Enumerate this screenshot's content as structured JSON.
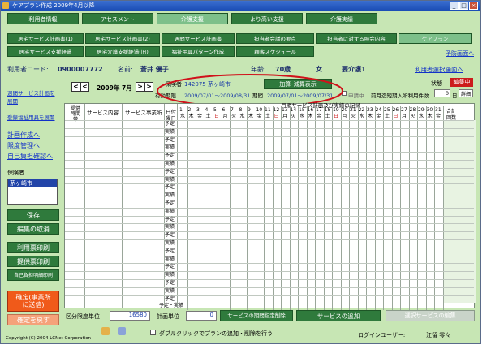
{
  "title": "ケアプラン作成 2009年4月以降",
  "main_tabs": [
    "利用者情報",
    "アセスメント",
    "介護支援",
    "より高い支援",
    "介護実績"
  ],
  "sub_row1": [
    "居宅サービス計画書(1)",
    "居宅サービス計画書(2)",
    "週間サービス計画書",
    "担当者会議の要点",
    "担当者に対する照会内容",
    "ケアプラン"
  ],
  "sub_row2": [
    "居宅サービス支援経過",
    "居宅介護支援経過(旧)",
    "福祉用具パターン作成",
    "顧客スケジュール"
  ],
  "yobou_link": "予防画面へ",
  "user": {
    "code_label": "利用者コード:",
    "code": "0900007772",
    "name_label": "名前:",
    "name": "蒼井 優子",
    "age_label": "年齢:",
    "age": "70歳",
    "sex": "女",
    "care_level": "要介護1",
    "select_link": "利用者選択画面へ"
  },
  "left": {
    "links": [
      "週間サービス計画を展開",
      "登録福祉用具を展開",
      "計画作成へ",
      "限度管理へ",
      "自己負担確認へ"
    ],
    "insurer_label": "保険者",
    "insurer_item": "茅ヶ崎市",
    "save": "保存",
    "cancel": "編集の取消",
    "print_use": "利用票印刷",
    "print_provide": "提供票印刷",
    "print_selfpay": "自己負担明細印刷",
    "confirm": "確定(事業所\nに送信)",
    "unconfirm": "確定を戻す"
  },
  "header": {
    "prev": "<",
    "next": ">",
    "month": "2009年 7月",
    "insurer_label": "保険者",
    "insurer_value": "142075 茅ヶ崎市",
    "valid_label": "有効期限",
    "valid_value": "2009/07/01〜2009/08/31",
    "period_label": "期間",
    "period_value": "2009/07/01〜2009/07/31",
    "kasan_button": "加算･減算表示",
    "shinsei_label": "申請中",
    "prev_month_label": "前月迄短期入所利用件数",
    "prev_month_value": "0",
    "unit_label": "日",
    "detail_button": "詳細",
    "status_label": "状態",
    "status_value": "編集中"
  },
  "grid": {
    "col_time": "提供\n時間\n帯",
    "col_service": "サービス内容",
    "col_provider": "サービス事業所",
    "record_title": "月間サービス計画及び実績の記録",
    "row_day": "日付",
    "row_weekday": "曜日",
    "days": [
      "1",
      "2",
      "3",
      "4",
      "5",
      "6",
      "7",
      "8",
      "9",
      "10",
      "11",
      "12",
      "13",
      "14",
      "15",
      "16",
      "17",
      "18",
      "19",
      "20",
      "21",
      "22",
      "23",
      "24",
      "25",
      "26",
      "27",
      "28",
      "29",
      "30",
      "31"
    ],
    "weekdays": [
      "水",
      "木",
      "金",
      "土",
      "日",
      "月",
      "火",
      "水",
      "木",
      "金",
      "土",
      "日",
      "月",
      "火",
      "水",
      "木",
      "金",
      "土",
      "日",
      "月",
      "火",
      "水",
      "木",
      "金",
      "土",
      "日",
      "月",
      "火",
      "水",
      "木",
      "金"
    ],
    "total_label": "合計",
    "count_label": "回数",
    "row_plan": "予定",
    "row_actual": "実績",
    "bottom_row": "予定・実績"
  },
  "bottom": {
    "limit_label": "区分限度単位",
    "limit_value": "16580",
    "plan_unit_label": "計画単位",
    "plan_unit_value": "0",
    "delete_by_period": "サービスの期間指定削除",
    "add_service": "サービスの追加",
    "edit_selected": "選択サービスの編集",
    "dblclick_label": "ダブルクリックでプランの追加・削除を行う",
    "login_label": "ログインユーザー:",
    "login_user": "江留 零々",
    "copyright": "Copyright (C) 2004 LCNet Corporation"
  },
  "colors": {
    "accent": "#2f7a3c",
    "bg": "#c7e6b4",
    "red": "#cc1b1b"
  }
}
